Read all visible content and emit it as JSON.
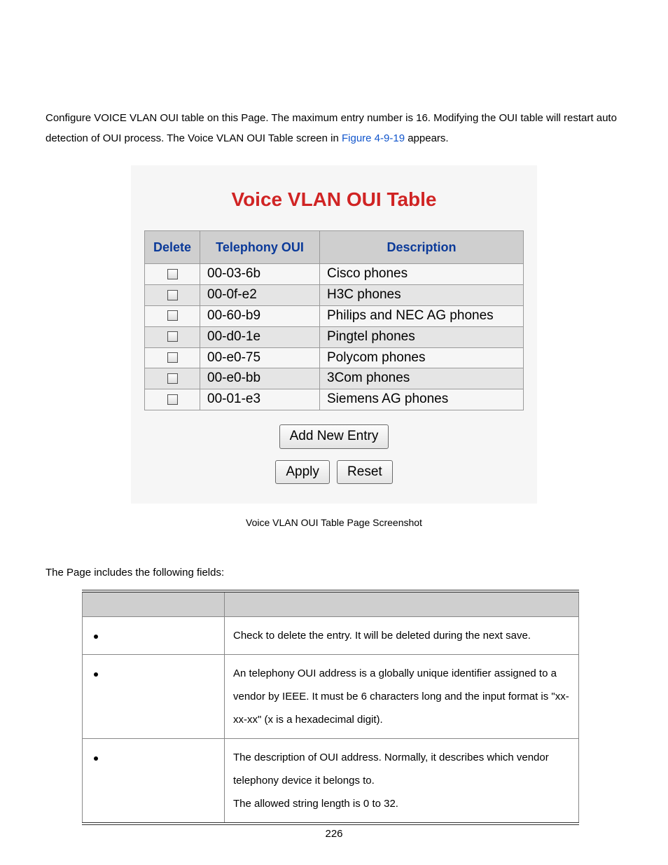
{
  "intro": {
    "before_link": "Configure VOICE VLAN OUI table on this Page. The maximum entry number is 16. Modifying the OUI table will restart auto detection of OUI process. The Voice VLAN OUI Table screen in ",
    "link_text": "Figure 4-9-19",
    "after_link": " appears."
  },
  "shot": {
    "title": "Voice VLAN OUI Table",
    "headers": {
      "del": "Delete",
      "oui": "Telephony OUI",
      "desc": "Description"
    },
    "rows": [
      {
        "oui": "00-03-6b",
        "desc": "Cisco phones"
      },
      {
        "oui": "00-0f-e2",
        "desc": "H3C phones"
      },
      {
        "oui": "00-60-b9",
        "desc": "Philips and NEC AG phones"
      },
      {
        "oui": "00-d0-1e",
        "desc": "Pingtel phones"
      },
      {
        "oui": "00-e0-75",
        "desc": "Polycom phones"
      },
      {
        "oui": "00-e0-bb",
        "desc": "3Com phones"
      },
      {
        "oui": "00-01-e3",
        "desc": "Siemens AG phones"
      }
    ],
    "buttons": {
      "add": "Add New Entry",
      "apply": "Apply",
      "reset": "Reset"
    }
  },
  "caption": "Voice VLAN OUI Table Page Screenshot",
  "fields_intro": "The Page includes the following fields:",
  "fields": [
    {
      "desc": "Check to delete the entry. It will be deleted during the next save."
    },
    {
      "desc": "An telephony OUI address is a globally unique identifier assigned to a vendor by IEEE. It must be 6 characters long and the input format is \"xx-xx-xx\" (x is a hexadecimal digit)."
    },
    {
      "desc": "The description of OUI address. Normally, it describes which vendor telephony device it belongs to.\nThe allowed string length is 0 to 32."
    }
  ],
  "page_number": "226"
}
